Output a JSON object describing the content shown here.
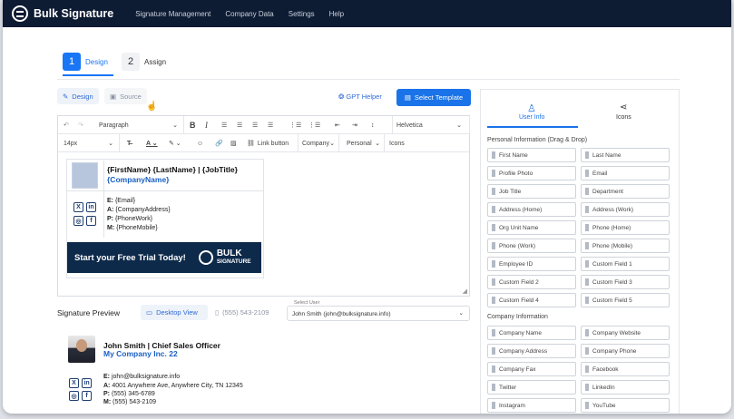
{
  "header": {
    "brand": "Bulk Signature",
    "nav": [
      "Signature Management",
      "Company Data",
      "Settings",
      "Help"
    ]
  },
  "steps": [
    {
      "num": "1",
      "label": "Design"
    },
    {
      "num": "2",
      "label": "Assign"
    }
  ],
  "mode": {
    "design": "Design",
    "source": "Source"
  },
  "actions": {
    "gpt": "GPT Helper",
    "select_template": "Select Template"
  },
  "toolbar": {
    "paragraph": "Paragraph",
    "font": "Helvetica",
    "size": "14px",
    "link_button": "Link button",
    "company": "Company",
    "personal": "Personal",
    "icons": "Icons"
  },
  "editor_sig": {
    "name_line": "{FirstName} {LastName} | {JobTitle}",
    "company": "{CompanyName}",
    "email_lbl": "E:",
    "email": "{Email}",
    "addr_lbl": "A:",
    "addr": "{CompanyAddress}",
    "phone_lbl": "P:",
    "phone": "{PhoneWork}",
    "mobile_lbl": "M:",
    "mobile": "{PhoneMobile}",
    "banner": "Start your Free Trial Today!",
    "banner_logo1": "BULK",
    "banner_logo2": "SIGNATURE"
  },
  "preview": {
    "title": "Signature Preview",
    "desktop": "Desktop View",
    "mobile": "(555) 543-2109",
    "select_user_label": "Select User",
    "select_user_value": "John Smith (john@bulksignature.info)",
    "name_line": "John Smith | Chief Sales Officer",
    "company": "My Company Inc. 22",
    "email_lbl": "E:",
    "email": "john@bulksignature.info",
    "addr_lbl": "A:",
    "addr": "4001 Anywhere Ave, Anywhere City, TN 12345",
    "phone_lbl": "P:",
    "phone": "(555) 345-6789",
    "mobile_lbl": "M:"
  },
  "panel": {
    "tab_user": "User Info",
    "tab_icons": "Icons",
    "personal_title": "Personal Information (Drag & Drop)",
    "personal_fields": [
      "First Name",
      "Last Name",
      "Profile Photo",
      "Email",
      "Job Title",
      "Department",
      "Address (Home)",
      "Address (Work)",
      "Org Unit Name",
      "Phone (Home)",
      "Phone (Work)",
      "Phone (Mobile)",
      "Employee ID",
      "Custom Field 1",
      "Custom Field 2",
      "Custom Field 3",
      "Custom Field 4",
      "Custom Field 5"
    ],
    "company_title": "Company Information",
    "company_fields": [
      "Company Name",
      "Company Website",
      "Company Address",
      "Company Phone",
      "Company Fax",
      "Facebook",
      "Twitter",
      "LinkedIn",
      "Instagram",
      "YouTube"
    ]
  },
  "colors": {
    "header_bg": "#0d1b33",
    "accent": "#1a73e8",
    "step_active": "#1976f5"
  }
}
